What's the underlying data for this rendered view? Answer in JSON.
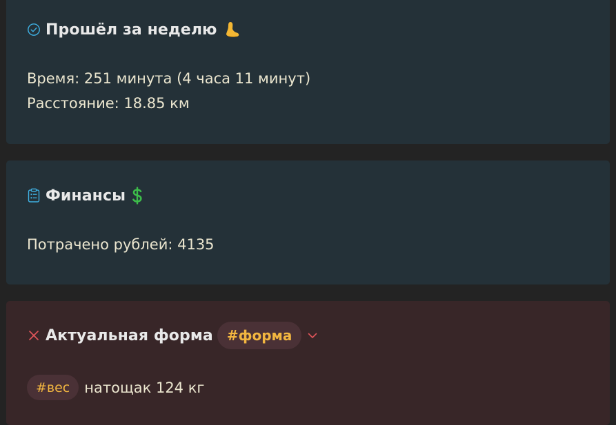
{
  "walk": {
    "title": "Прошёл за неделю",
    "time_line": "Время: 251 минута (4 часа 11 минут)",
    "distance_line": "Расстояние: 18.85 км",
    "status_icon": "check-circle-icon",
    "emoji": "foot-icon"
  },
  "finance": {
    "title": "Финансы",
    "spent_line": "Потрачено рублей: 4135",
    "status_icon": "clipboard-list-icon",
    "emoji": "dollar-sign-icon"
  },
  "form": {
    "title": "Актуальная форма",
    "tag": "#форма",
    "status_icon": "close-icon",
    "weight_tag": "#вес",
    "weight_text": "натощак 124 кг"
  },
  "colors": {
    "background": "#232323",
    "card_blue": "#243138",
    "card_red": "#382628",
    "tag_text": "#f2b640",
    "accent_blue": "#3fb1e3",
    "accent_red": "#e0555a"
  }
}
